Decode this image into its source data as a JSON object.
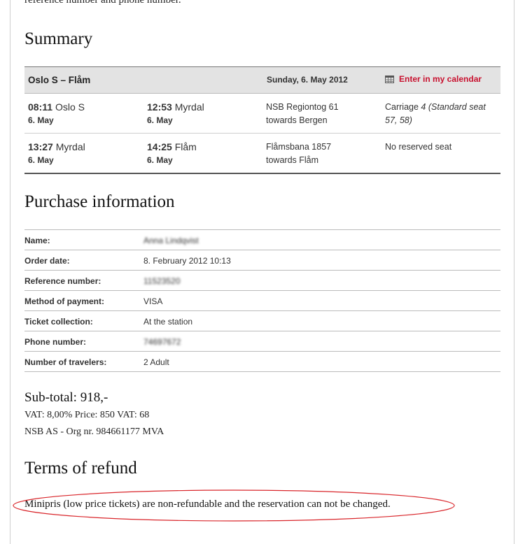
{
  "intro_text": "reference number and phone number.",
  "summary": {
    "heading": "Summary",
    "route": "Oslo S – Flåm",
    "date": "Sunday, 6. May 2012",
    "calendar_link": "Enter in my calendar",
    "legs": [
      {
        "dep_time": "08:11",
        "dep_station": "Oslo S",
        "dep_date": "6. May",
        "arr_time": "12:53",
        "arr_station": "Myrdal",
        "arr_date": "6. May",
        "train": "NSB Regiontog 61",
        "towards": "towards Bergen",
        "seat_prefix": "Carriage ",
        "seat_carriage": "4",
        "seat_detail": "(Standard seat 57, 58)"
      },
      {
        "dep_time": "13:27",
        "dep_station": "Myrdal",
        "dep_date": "6. May",
        "arr_time": "14:25",
        "arr_station": "Flåm",
        "arr_date": "6. May",
        "train": "Flåmsbana 1857",
        "towards": "towards Flåm",
        "seat_text": "No reserved seat"
      }
    ]
  },
  "purchase": {
    "heading": "Purchase information",
    "rows": [
      {
        "label": "Name:",
        "value": "Anna Lindqvist"
      },
      {
        "label": "Order date:",
        "value": "8. February 2012 10:13"
      },
      {
        "label": "Reference number:",
        "value": "11523520"
      },
      {
        "label": "Method of payment:",
        "value": "VISA"
      },
      {
        "label": "Ticket collection:",
        "value": "At the station"
      },
      {
        "label": "Phone number:",
        "value": "74697672"
      },
      {
        "label": "Number of travelers:",
        "value": "2 Adult"
      }
    ]
  },
  "totals": {
    "subtotal": "Sub-total: 918,-",
    "vat": "VAT: 8,00% Price: 850 VAT: 68",
    "org": "NSB AS - Org nr. 984661177 MVA"
  },
  "refund": {
    "heading": "Terms of refund",
    "text": "Minipris (low price tickets) are non-refundable and the reservation can not be changed."
  },
  "colors": {
    "accent_red": "#c8102e",
    "header_bg": "#e3e3e3"
  }
}
